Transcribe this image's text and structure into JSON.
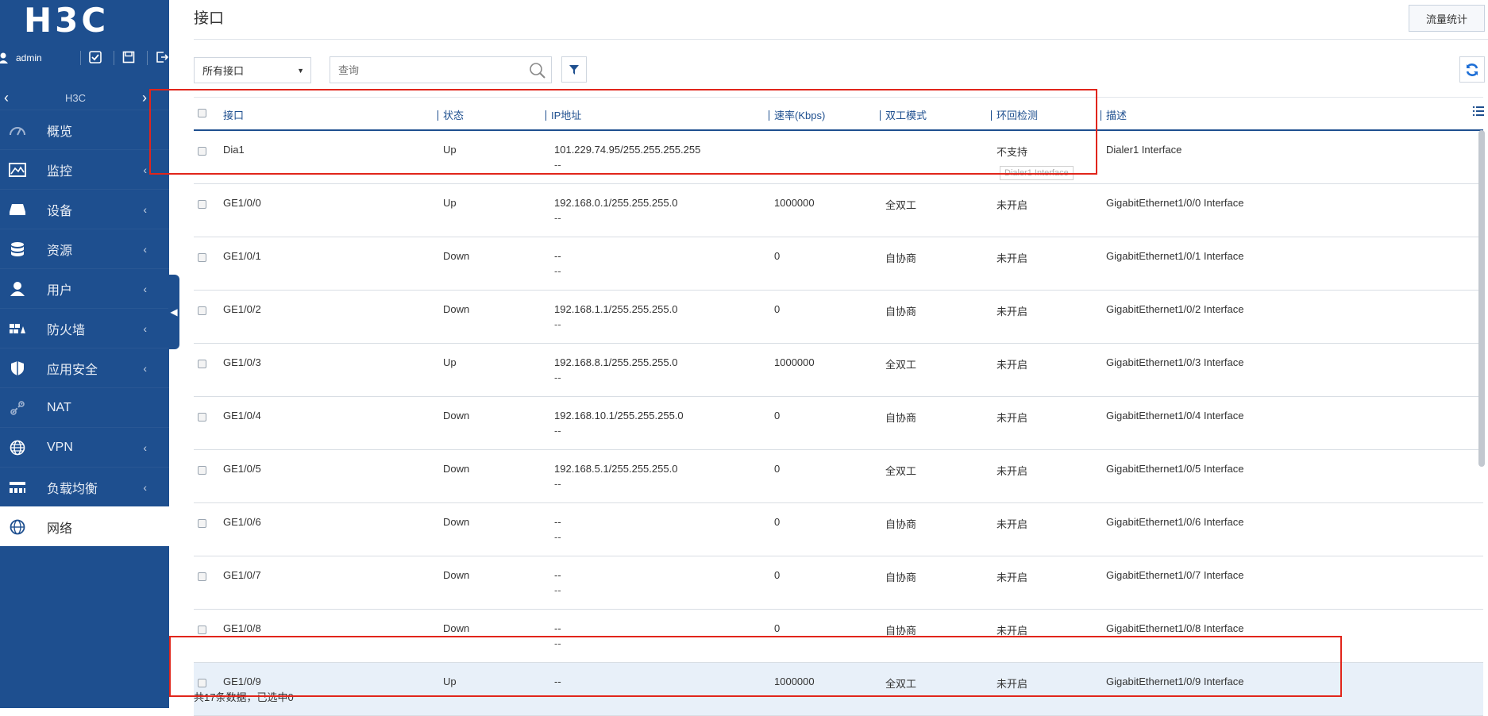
{
  "brand": {
    "logo_text": "H3C"
  },
  "userbar": {
    "username": "admin"
  },
  "context": {
    "device": "H3C"
  },
  "sidebar": {
    "items": [
      {
        "label": "概览",
        "icon": "dashboard-icon",
        "has_caret": false
      },
      {
        "label": "监控",
        "icon": "monitor-icon",
        "has_caret": true
      },
      {
        "label": "设备",
        "icon": "device-icon",
        "has_caret": true
      },
      {
        "label": "资源",
        "icon": "database-icon",
        "has_caret": true
      },
      {
        "label": "用户",
        "icon": "user-icon",
        "has_caret": true
      },
      {
        "label": "防火墙",
        "icon": "firewall-icon",
        "has_caret": true
      },
      {
        "label": "应用安全",
        "icon": "shield-icon",
        "has_caret": true
      },
      {
        "label": "NAT",
        "icon": "nat-icon",
        "has_caret": false
      },
      {
        "label": "VPN",
        "icon": "globe-icon",
        "has_caret": true
      },
      {
        "label": "负载均衡",
        "icon": "load-balance-icon",
        "has_caret": true
      },
      {
        "label": "网络",
        "icon": "network-globe-icon",
        "has_caret": false,
        "active": true
      }
    ]
  },
  "header": {
    "title": "接口",
    "traffic_button": "流量统计"
  },
  "toolbar": {
    "filter_select": "所有接口",
    "search_placeholder": "查询"
  },
  "table": {
    "columns": [
      "接口",
      "状态",
      "IP地址",
      "速率(Kbps)",
      "双工模式",
      "环回检测",
      "描述"
    ],
    "rows": [
      {
        "name": "Dia1",
        "status": "Up",
        "ip": "101.229.74.95/255.255.255.255",
        "ip2": "--",
        "rate": "",
        "duplex": "",
        "loopback": "不支持",
        "desc": "Dialer1 Interface"
      },
      {
        "name": "GE1/0/0",
        "status": "Up",
        "ip": "192.168.0.1/255.255.255.0",
        "ip2": "--",
        "rate": "1000000",
        "duplex": "全双工",
        "loopback": "未开启",
        "desc": "GigabitEthernet1/0/0 Interface"
      },
      {
        "name": "GE1/0/1",
        "status": "Down",
        "ip": "--",
        "ip2": "--",
        "rate": "0",
        "duplex": "自协商",
        "loopback": "未开启",
        "desc": "GigabitEthernet1/0/1 Interface"
      },
      {
        "name": "GE1/0/2",
        "status": "Down",
        "ip": "192.168.1.1/255.255.255.0",
        "ip2": "--",
        "rate": "0",
        "duplex": "自协商",
        "loopback": "未开启",
        "desc": "GigabitEthernet1/0/2 Interface"
      },
      {
        "name": "GE1/0/3",
        "status": "Up",
        "ip": "192.168.8.1/255.255.255.0",
        "ip2": "--",
        "rate": "1000000",
        "duplex": "全双工",
        "loopback": "未开启",
        "desc": "GigabitEthernet1/0/3 Interface"
      },
      {
        "name": "GE1/0/4",
        "status": "Down",
        "ip": "192.168.10.1/255.255.255.0",
        "ip2": "--",
        "rate": "0",
        "duplex": "自协商",
        "loopback": "未开启",
        "desc": "GigabitEthernet1/0/4 Interface"
      },
      {
        "name": "GE1/0/5",
        "status": "Down",
        "ip": "192.168.5.1/255.255.255.0",
        "ip2": "--",
        "rate": "0",
        "duplex": "全双工",
        "loopback": "未开启",
        "desc": "GigabitEthernet1/0/5 Interface"
      },
      {
        "name": "GE1/0/6",
        "status": "Down",
        "ip": "--",
        "ip2": "--",
        "rate": "0",
        "duplex": "自协商",
        "loopback": "未开启",
        "desc": "GigabitEthernet1/0/6 Interface"
      },
      {
        "name": "GE1/0/7",
        "status": "Down",
        "ip": "--",
        "ip2": "--",
        "rate": "0",
        "duplex": "自协商",
        "loopback": "未开启",
        "desc": "GigabitEthernet1/0/7 Interface"
      },
      {
        "name": "GE1/0/8",
        "status": "Down",
        "ip": "--",
        "ip2": "--",
        "rate": "0",
        "duplex": "自协商",
        "loopback": "未开启",
        "desc": "GigabitEthernet1/0/8 Interface"
      },
      {
        "name": "GE1/0/9",
        "status": "Up",
        "ip": "--",
        "ip2": "",
        "rate": "1000000",
        "duplex": "全双工",
        "loopback": "未开启",
        "desc": "GigabitEthernet1/0/9 Interface"
      }
    ]
  },
  "tooltip": "Dialer1 Interface",
  "footer": {
    "summary": "共17条数据，已选中0"
  },
  "colors": {
    "sidebar": "#1e4f8f",
    "highlight": "#e1251b",
    "accent": "#1e4f8f"
  }
}
